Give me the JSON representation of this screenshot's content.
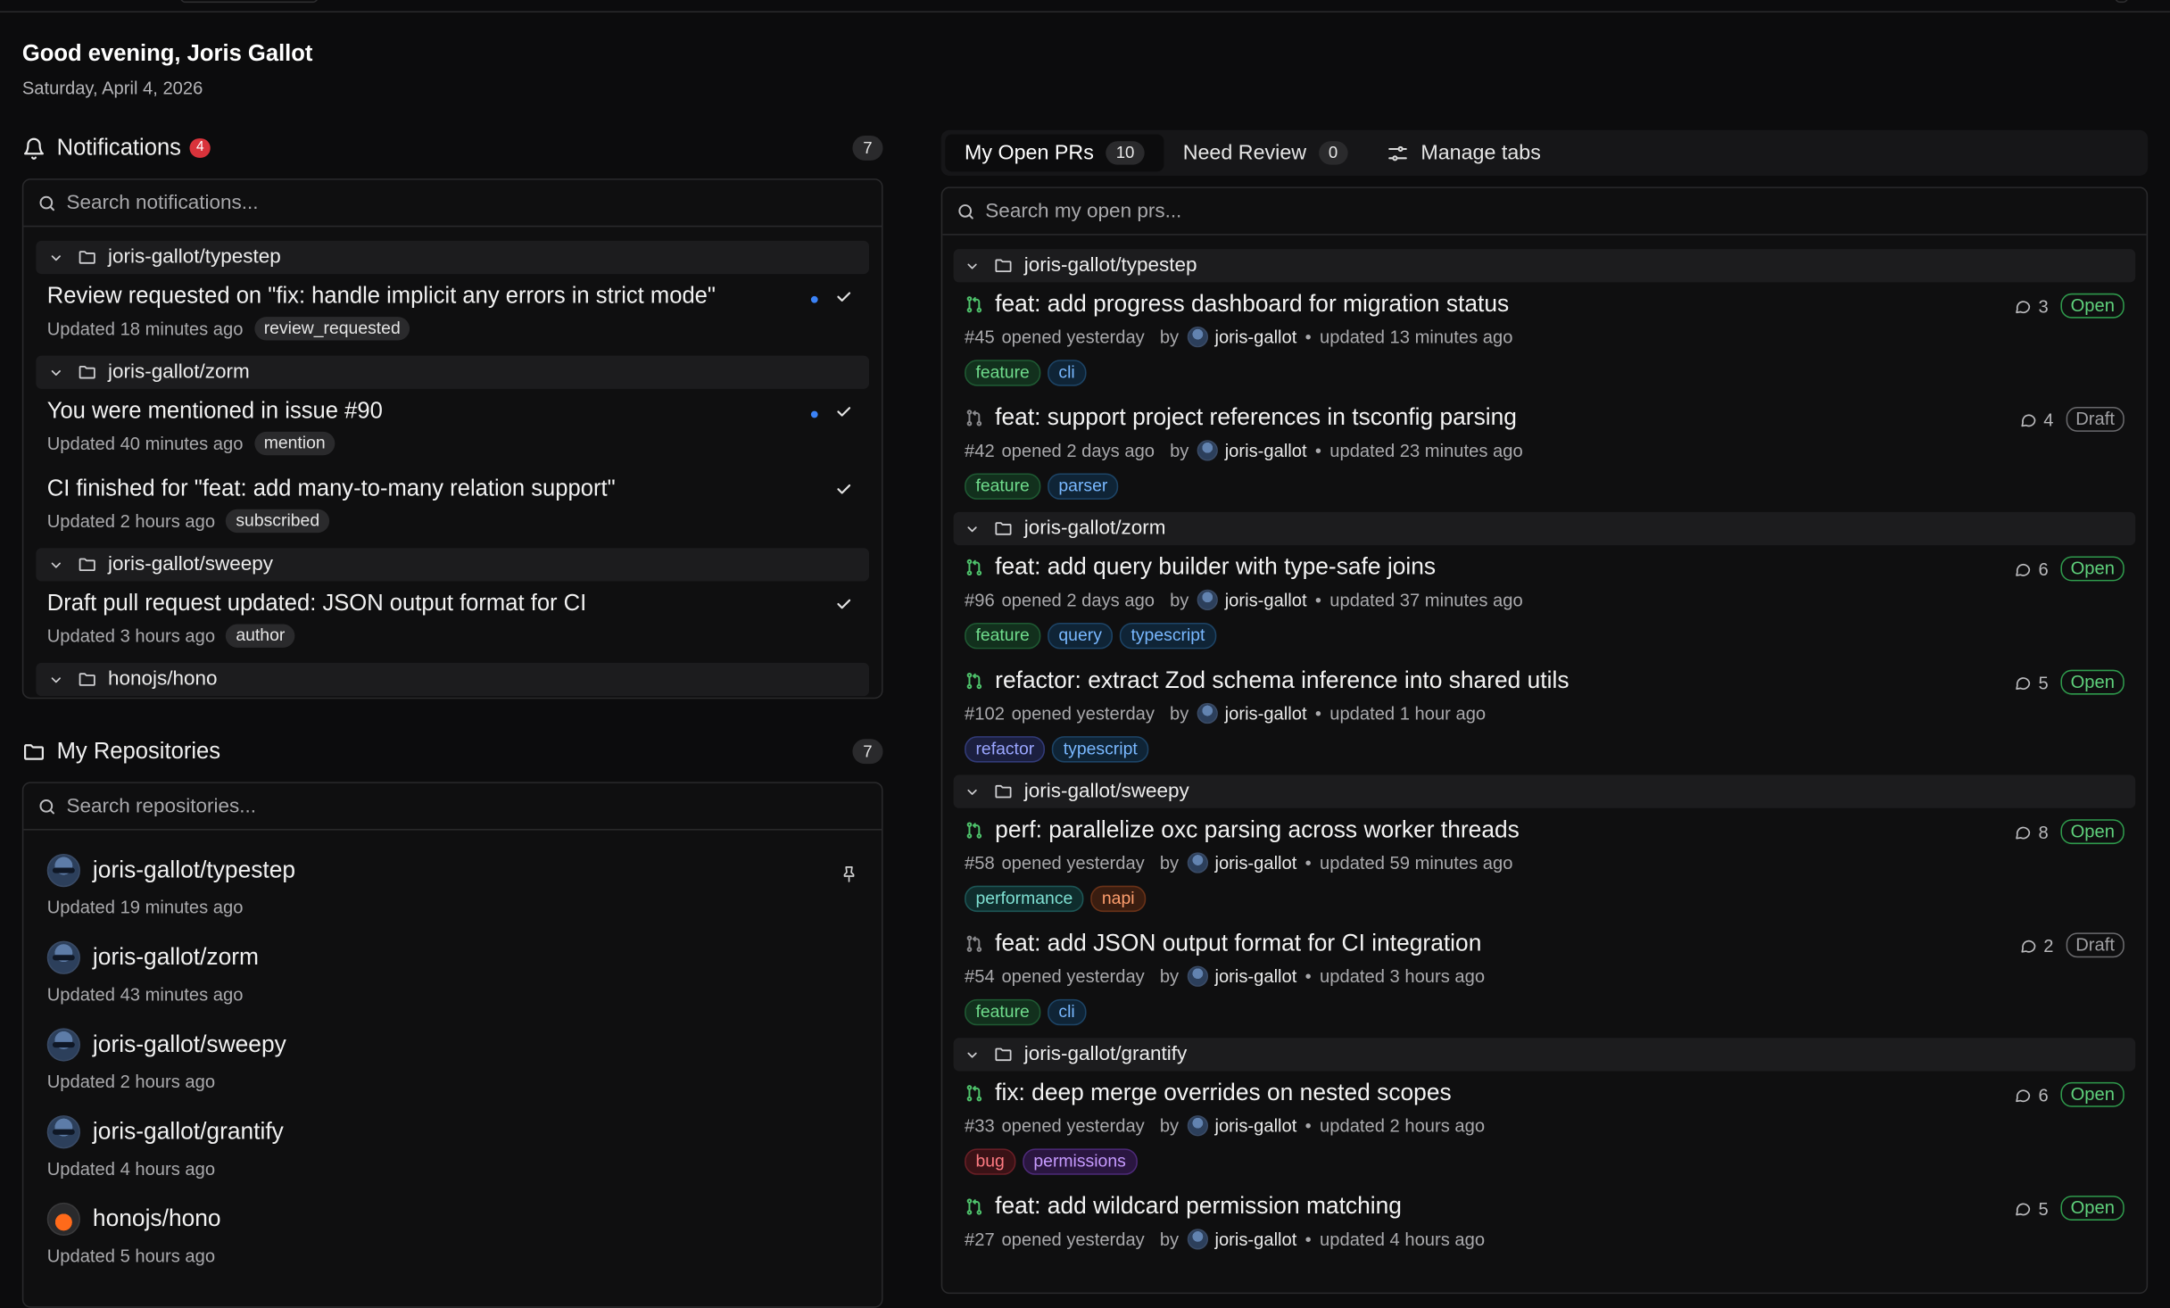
{
  "header": {
    "greeting": "Good evening, Joris Gallot",
    "date": "Saturday, April 4, 2026"
  },
  "notifications": {
    "title": "Notifications",
    "unread_badge": "4",
    "count": "7",
    "search_placeholder": "Search notifications...",
    "groups": [
      {
        "repo": "joris-gallot/typestep",
        "items": [
          {
            "title": "Review requested on \"fix: handle implicit any errors in strict mode\"",
            "updated": "Updated 18 minutes ago",
            "reason": "review_requested",
            "unread": true
          }
        ]
      },
      {
        "repo": "joris-gallot/zorm",
        "items": [
          {
            "title": "You were mentioned in issue #90",
            "updated": "Updated 40 minutes ago",
            "reason": "mention",
            "unread": true
          },
          {
            "title": "CI finished for \"feat: add many-to-many relation support\"",
            "updated": "Updated 2 hours ago",
            "reason": "subscribed",
            "unread": false
          }
        ]
      },
      {
        "repo": "joris-gallot/sweepy",
        "items": [
          {
            "title": "Draft pull request updated: JSON output format for CI",
            "updated": "Updated 3 hours ago",
            "reason": "author",
            "unread": false
          }
        ]
      },
      {
        "repo": "honojs/hono",
        "items": []
      }
    ]
  },
  "repositories": {
    "title": "My Repositories",
    "count": "7",
    "search_placeholder": "Search repositories...",
    "items": [
      {
        "name": "joris-gallot/typestep",
        "updated": "Updated 19 minutes ago",
        "pinned": true
      },
      {
        "name": "joris-gallot/zorm",
        "updated": "Updated 43 minutes ago"
      },
      {
        "name": "joris-gallot/sweepy",
        "updated": "Updated 2 hours ago"
      },
      {
        "name": "joris-gallot/grantify",
        "updated": "Updated 4 hours ago"
      },
      {
        "name": "honojs/hono",
        "updated": "Updated 5 hours ago"
      }
    ]
  },
  "prs": {
    "tabs": [
      {
        "label": "My Open PRs",
        "count": "10"
      },
      {
        "label": "Need Review",
        "count": "0"
      }
    ],
    "manage_label": "Manage tabs",
    "search_placeholder": "Search my open prs...",
    "groups": [
      {
        "repo": "joris-gallot/typestep",
        "items": [
          {
            "title": "feat: add progress dashboard for migration status",
            "number": "#45",
            "opened": "opened yesterday",
            "by": "by",
            "author": "joris-gallot",
            "updated": "updated 13 minutes ago",
            "comments": "3",
            "status": "Open",
            "labels": [
              {
                "name": "feature",
                "color": "green"
              },
              {
                "name": "cli",
                "color": "blue"
              }
            ]
          },
          {
            "title": "feat: support project references in tsconfig parsing",
            "number": "#42",
            "opened": "opened 2 days ago",
            "by": "by",
            "author": "joris-gallot",
            "updated": "updated 23 minutes ago",
            "comments": "4",
            "status": "Draft",
            "labels": [
              {
                "name": "feature",
                "color": "green"
              },
              {
                "name": "parser",
                "color": "blue"
              }
            ]
          }
        ]
      },
      {
        "repo": "joris-gallot/zorm",
        "items": [
          {
            "title": "feat: add query builder with type-safe joins",
            "number": "#96",
            "opened": "opened 2 days ago",
            "by": "by",
            "author": "joris-gallot",
            "updated": "updated 37 minutes ago",
            "comments": "6",
            "status": "Open",
            "labels": [
              {
                "name": "feature",
                "color": "green"
              },
              {
                "name": "query",
                "color": "blue"
              },
              {
                "name": "typescript",
                "color": "blue"
              }
            ]
          },
          {
            "title": "refactor: extract Zod schema inference into shared utils",
            "number": "#102",
            "opened": "opened yesterday",
            "by": "by",
            "author": "joris-gallot",
            "updated": "updated 1 hour ago",
            "comments": "5",
            "status": "Open",
            "labels": [
              {
                "name": "refactor",
                "color": "indigo"
              },
              {
                "name": "typescript",
                "color": "blue"
              }
            ]
          }
        ]
      },
      {
        "repo": "joris-gallot/sweepy",
        "items": [
          {
            "title": "perf: parallelize oxc parsing across worker threads",
            "number": "#58",
            "opened": "opened yesterday",
            "by": "by",
            "author": "joris-gallot",
            "updated": "updated 59 minutes ago",
            "comments": "8",
            "status": "Open",
            "labels": [
              {
                "name": "performance",
                "color": "teal"
              },
              {
                "name": "napi",
                "color": "orange"
              }
            ]
          },
          {
            "title": "feat: add JSON output format for CI integration",
            "number": "#54",
            "opened": "opened yesterday",
            "by": "by",
            "author": "joris-gallot",
            "updated": "updated 3 hours ago",
            "comments": "2",
            "status": "Draft",
            "labels": [
              {
                "name": "feature",
                "color": "green"
              },
              {
                "name": "cli",
                "color": "blue"
              }
            ]
          }
        ]
      },
      {
        "repo": "joris-gallot/grantify",
        "items": [
          {
            "title": "fix: deep merge overrides on nested scopes",
            "number": "#33",
            "opened": "opened yesterday",
            "by": "by",
            "author": "joris-gallot",
            "updated": "updated 2 hours ago",
            "comments": "6",
            "status": "Open",
            "labels": [
              {
                "name": "bug",
                "color": "red"
              },
              {
                "name": "permissions",
                "color": "purple"
              }
            ]
          },
          {
            "title": "feat: add wildcard permission matching",
            "number": "#27",
            "opened": "opened yesterday",
            "by": "by",
            "author": "joris-gallot",
            "updated": "updated 4 hours ago",
            "comments": "5",
            "status": "Open",
            "labels": []
          }
        ]
      }
    ]
  }
}
